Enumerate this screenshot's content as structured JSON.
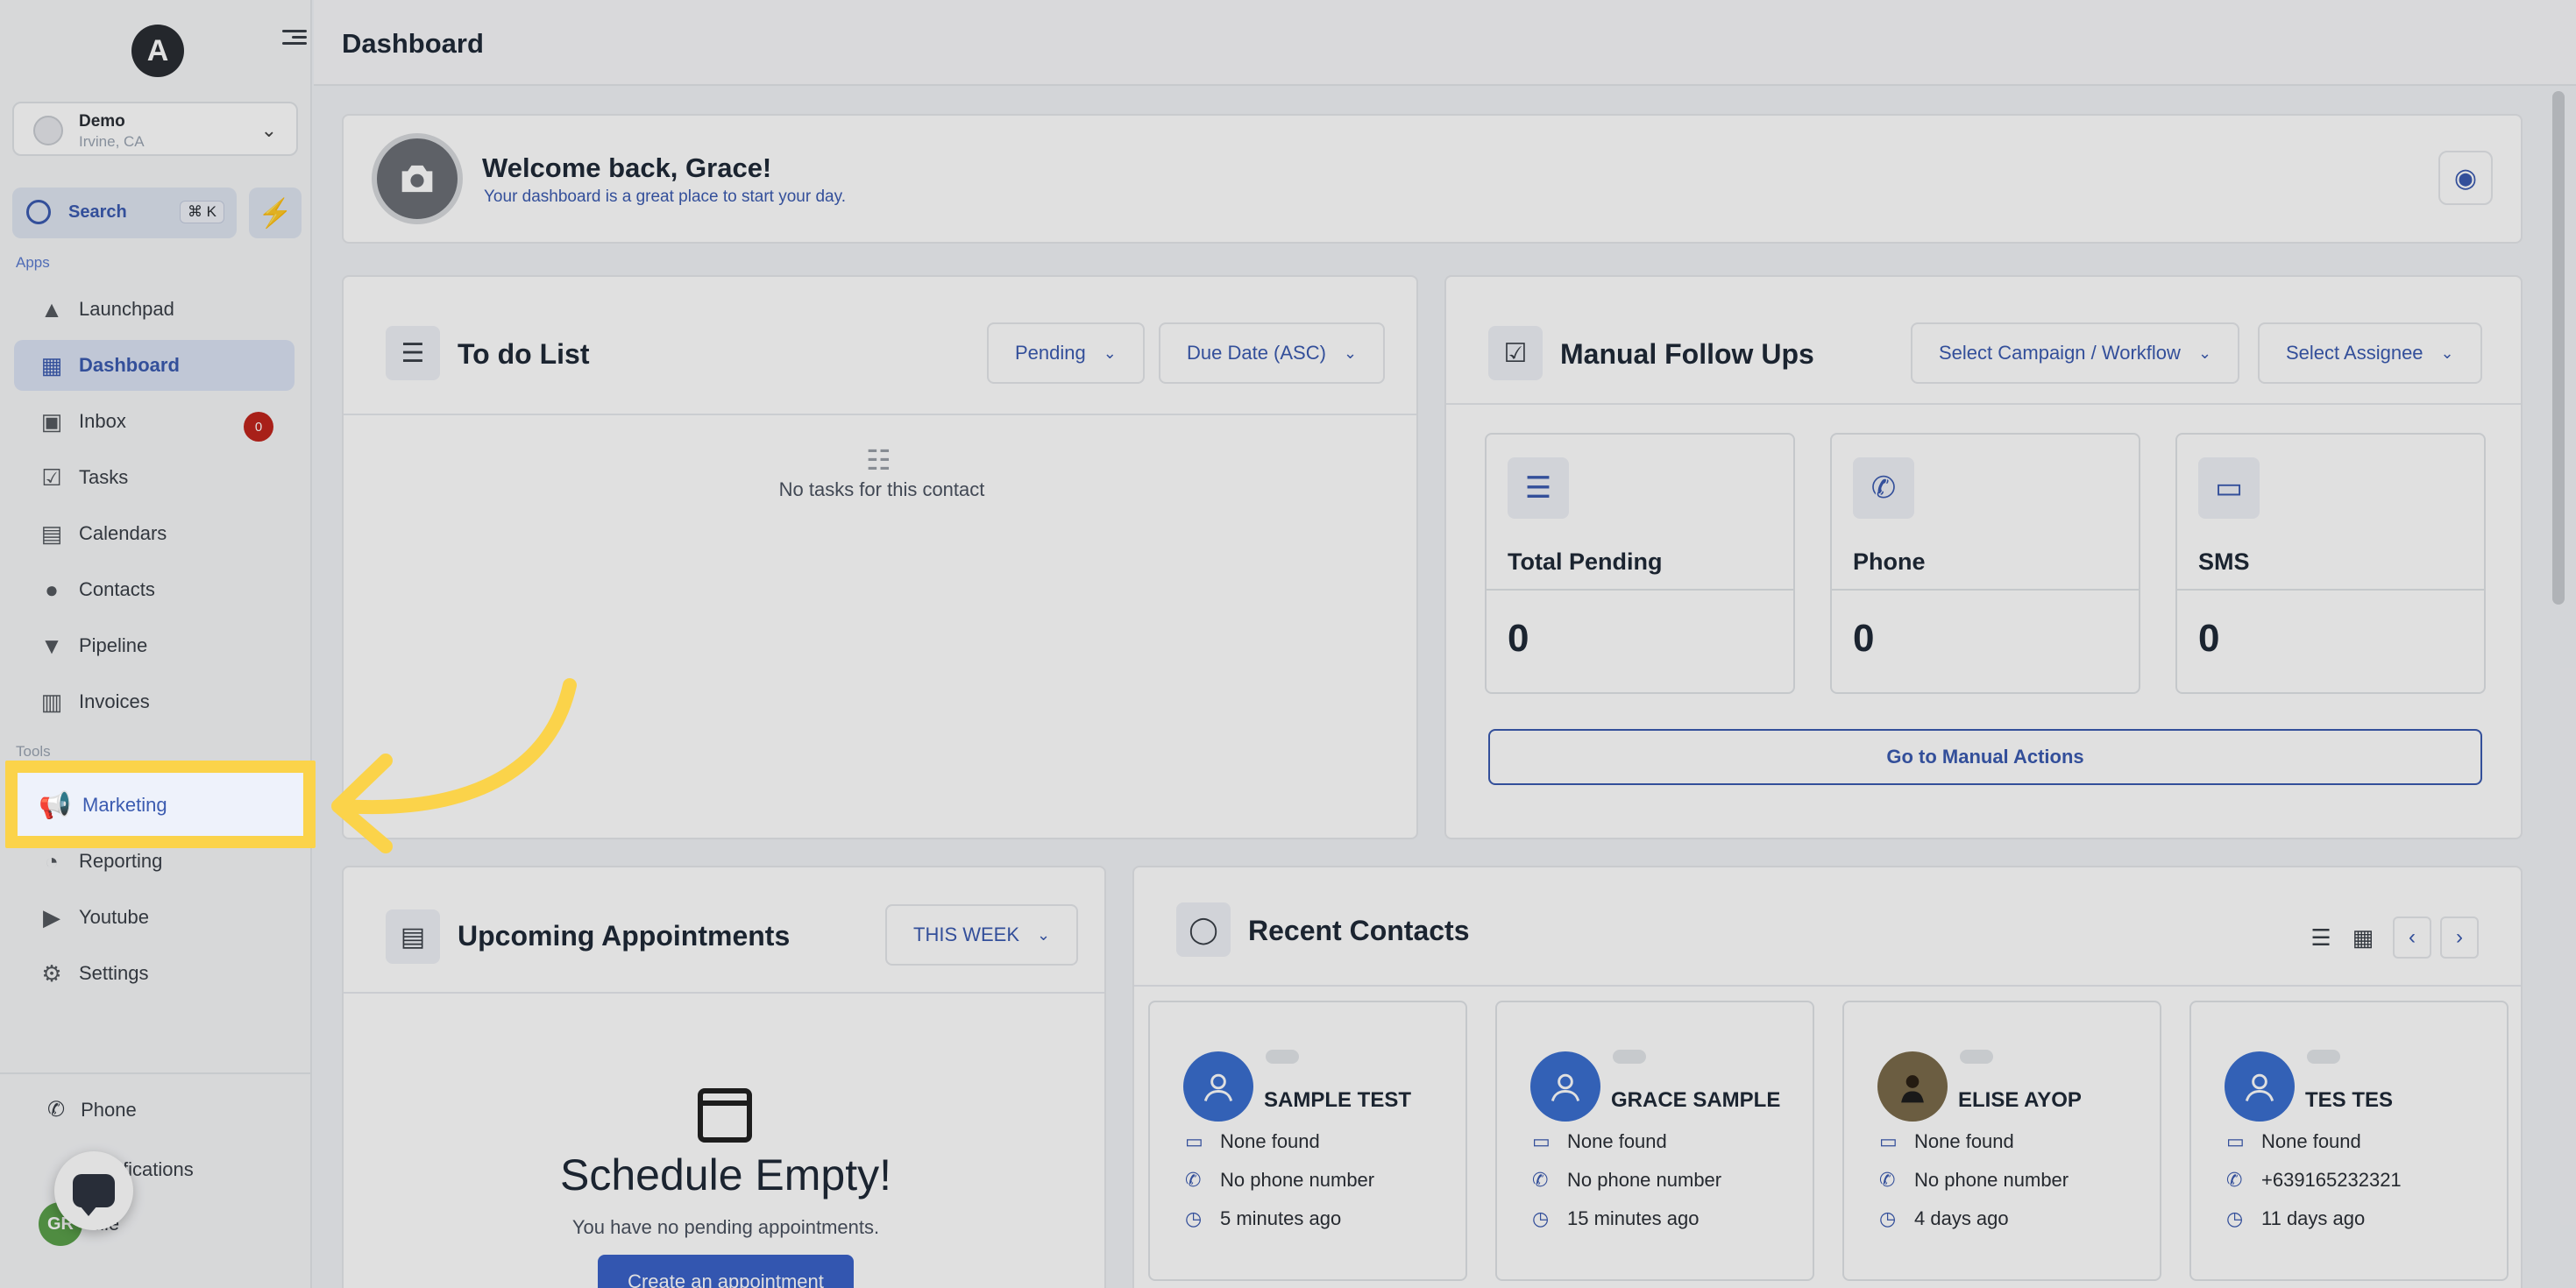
{
  "sidebar": {
    "logo_letter": "A",
    "account": {
      "name": "Demo",
      "location": "Irvine, CA"
    },
    "search": {
      "label": "Search",
      "shortcut": "⌘ K"
    },
    "apps_label": "Apps",
    "tools_label": "Tools",
    "apps": [
      {
        "label": "Launchpad",
        "icon": "rocket-icon"
      },
      {
        "label": "Dashboard",
        "icon": "grid-icon",
        "active": true
      },
      {
        "label": "Inbox",
        "icon": "inbox-icon",
        "badge": "0"
      },
      {
        "label": "Tasks",
        "icon": "clipboard-icon"
      },
      {
        "label": "Calendars",
        "icon": "calendar-icon"
      },
      {
        "label": "Contacts",
        "icon": "person-icon"
      },
      {
        "label": "Pipeline",
        "icon": "filter-icon"
      },
      {
        "label": "Invoices",
        "icon": "receipt-icon"
      }
    ],
    "tools": [
      {
        "label": "Marketing",
        "icon": "megaphone-icon"
      },
      {
        "label": "Reporting",
        "icon": "chart-icon"
      },
      {
        "label": "Youtube",
        "icon": "play-icon"
      },
      {
        "label": "Settings",
        "icon": "gear-icon"
      }
    ],
    "bottom": {
      "phone_label": "Phone",
      "notifications_label": "fications",
      "profile_label": "file",
      "profile_initials": "GR"
    }
  },
  "header": {
    "title": "Dashboard"
  },
  "welcome": {
    "title": "Welcome back, Grace!",
    "subtitle": "Your dashboard is a great place to start your day."
  },
  "todo": {
    "title": "To do List",
    "status_filter": "Pending",
    "sort_filter": "Due Date (ASC)",
    "empty_text": "No tasks for this contact"
  },
  "manual_follow_ups": {
    "title": "Manual Follow Ups",
    "campaign_filter": "Select Campaign / Workflow",
    "assignee_filter": "Select Assignee",
    "stats": [
      {
        "label": "Total Pending",
        "value": "0",
        "icon": "checklist-icon"
      },
      {
        "label": "Phone",
        "value": "0",
        "icon": "phone-icon"
      },
      {
        "label": "SMS",
        "value": "0",
        "icon": "message-icon"
      }
    ],
    "action_button": "Go to Manual Actions"
  },
  "appointments": {
    "title": "Upcoming Appointments",
    "range_filter": "THIS WEEK",
    "empty_title": "Schedule Empty!",
    "empty_subtitle": "You have no pending appointments.",
    "create_button": "Create an appointment"
  },
  "recent_contacts": {
    "title": "Recent Contacts",
    "contacts": [
      {
        "name": "SAMPLE TEST",
        "company": "None found",
        "phone": "No phone number",
        "time": "5 minutes ago"
      },
      {
        "name": "GRACE SAMPLE",
        "company": "None found",
        "phone": "No phone number",
        "time": "15 minutes ago"
      },
      {
        "name": "ELISE AYOP",
        "company": "None found",
        "phone": "No phone number",
        "time": "4 days ago"
      },
      {
        "name": "TES TES",
        "company": "None found",
        "phone": "+639165232321",
        "time": "11 days ago"
      }
    ]
  },
  "colors": {
    "accent": "#3b5bb0",
    "highlight": "#fbd34a",
    "badge": "#c0251d"
  }
}
